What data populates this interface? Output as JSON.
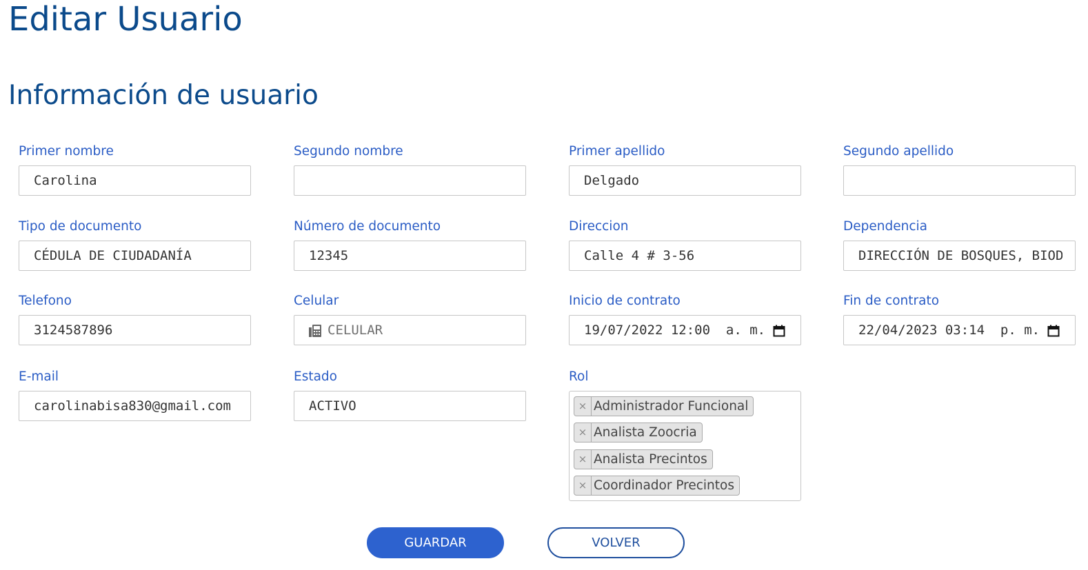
{
  "page": {
    "title": "Editar Usuario",
    "section_title": "Información de usuario"
  },
  "form": {
    "primer_nombre": {
      "label": "Primer nombre",
      "value": "Carolina"
    },
    "segundo_nombre": {
      "label": "Segundo nombre",
      "value": ""
    },
    "primer_apellido": {
      "label": "Primer apellido",
      "value": "Delgado"
    },
    "segundo_apellido": {
      "label": "Segundo apellido",
      "value": ""
    },
    "tipo_documento": {
      "label": "Tipo de documento",
      "value": "CÉDULA DE CIUDADANÍA"
    },
    "numero_documento": {
      "label": "Número de documento",
      "value": "12345"
    },
    "direccion": {
      "label": "Direccion",
      "value": "Calle 4 # 3-56"
    },
    "dependencia": {
      "label": "Dependencia",
      "value": "DIRECCIÓN DE BOSQUES, BIODIVERSIDAD"
    },
    "telefono": {
      "label": "Telefono",
      "value": "3124587896"
    },
    "celular": {
      "label": "Celular",
      "value": "",
      "placeholder": "CELULAR",
      "icon": "phone-icon"
    },
    "inicio_contrato": {
      "label": "Inicio de contrato",
      "value": "19/07/2022 12:00  a. m.",
      "icon": "calendar-icon"
    },
    "fin_contrato": {
      "label": "Fin de contrato",
      "value": "22/04/2023 03:14  p. m.",
      "icon": "calendar-icon"
    },
    "email": {
      "label": "E-mail",
      "value": "carolinabisa830@gmail.com"
    },
    "estado": {
      "label": "Estado",
      "value": "ACTIVO"
    },
    "rol": {
      "label": "Rol",
      "remove_symbol": "×",
      "selected": [
        "Administrador Funcional",
        "Analista Zoocria",
        "Analista Precintos",
        "Coordinador Precintos"
      ]
    }
  },
  "actions": {
    "save_label": "GUARDAR",
    "back_label": "VOLVER"
  },
  "colors": {
    "title": "#0b4a8b",
    "label": "#2a5cc5",
    "primary_button": "#2d62cf",
    "secondary_border": "#1f4f9e"
  }
}
